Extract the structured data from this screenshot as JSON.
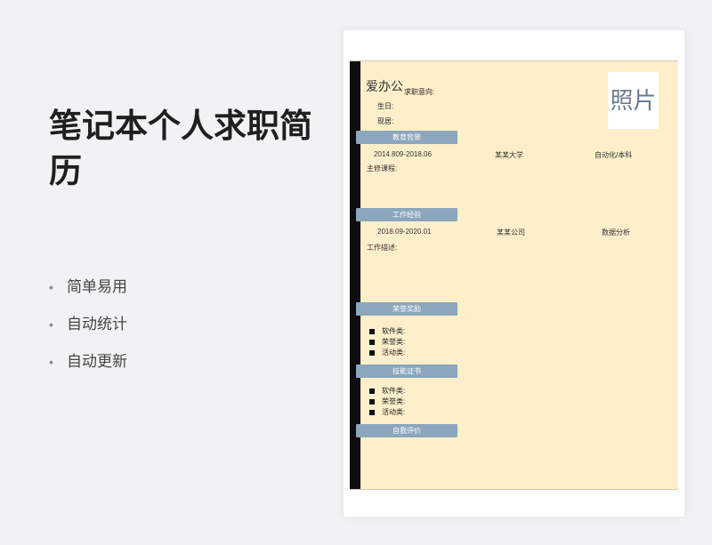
{
  "title": "笔记本个人求职简历",
  "features": [
    "简单易用",
    "自动统计",
    "自动更新"
  ],
  "resume": {
    "name": "爱办公",
    "job_intent_label": "求职意向:",
    "birthday_label": "生日:",
    "residence_label": "现居:",
    "photo_text": "照片",
    "education": {
      "header": "教育背景",
      "period": "2014.809-2018.06",
      "school": "某某大学",
      "major": "自动化/本科",
      "courses_label": "主修课程:"
    },
    "work": {
      "header": "工作经验",
      "period": "2018.09-2020.01",
      "company": "某某公司",
      "position": "数据分析",
      "desc_label": "工作描述:"
    },
    "awards": {
      "header": "荣誉奖励",
      "items": [
        "软件类:",
        "荣誉类:",
        "活动类:"
      ]
    },
    "skills": {
      "header": "技能证书",
      "items": [
        "软件类:",
        "荣誉类:",
        "活动类:"
      ]
    },
    "self_eval": {
      "header": "自我评价"
    }
  }
}
